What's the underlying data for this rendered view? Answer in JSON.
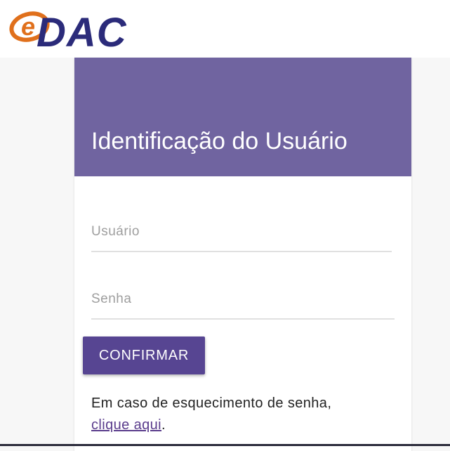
{
  "header": {
    "logo_text": "DAC",
    "logo_glyph": "e"
  },
  "card": {
    "title": "Identificação do Usuário",
    "username": {
      "placeholder": "Usuário",
      "value": ""
    },
    "password": {
      "placeholder": "Senha",
      "value": ""
    },
    "confirm_label": "CONFIRMAR",
    "help_text": "Em caso de esquecimento de senha,",
    "help_link": "clique aqui",
    "help_end": "."
  },
  "colors": {
    "header_bg": "#7064a0",
    "button_bg": "#574592",
    "logo_blue": "#2b2b7a",
    "logo_orange": "#e0701c"
  }
}
